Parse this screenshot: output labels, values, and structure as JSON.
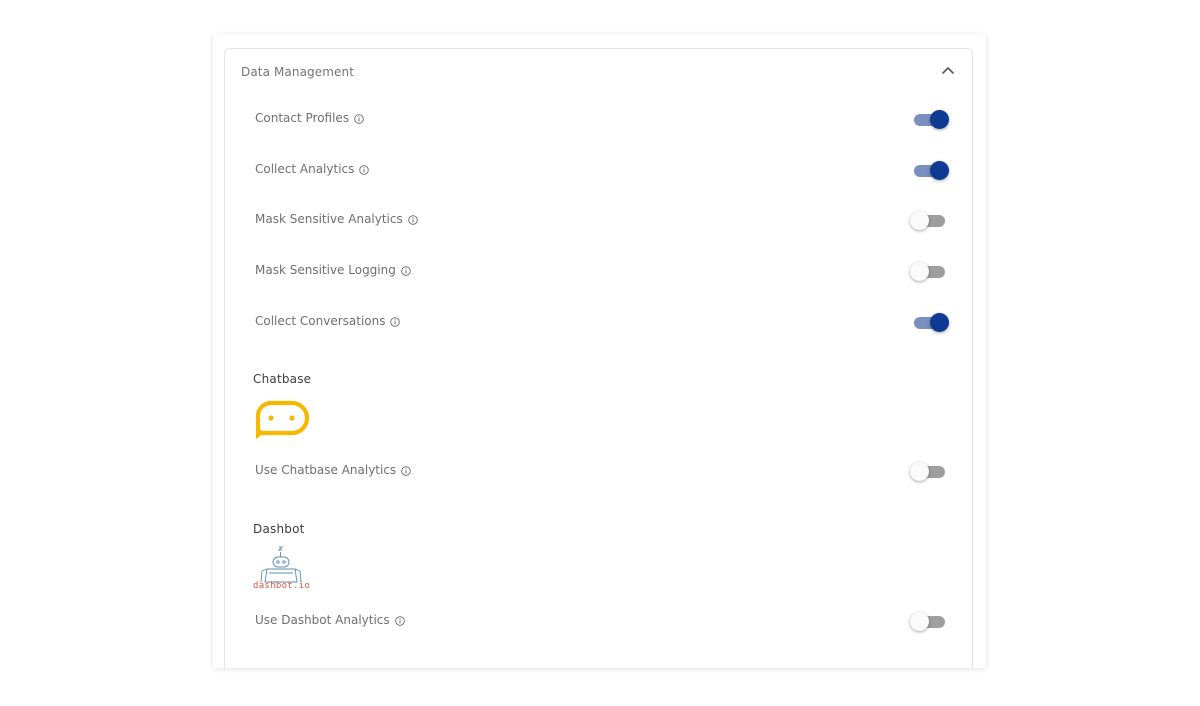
{
  "panel": {
    "title": "Data Management",
    "collapse_icon": "chevron-up-icon"
  },
  "settings": [
    {
      "label": "Contact Profiles",
      "enabled": true
    },
    {
      "label": "Collect Analytics",
      "enabled": true
    },
    {
      "label": "Mask Sensitive Analytics",
      "enabled": false
    },
    {
      "label": "Mask Sensitive Logging",
      "enabled": false
    },
    {
      "label": "Collect Conversations",
      "enabled": true
    }
  ],
  "chatbase": {
    "title": "Chatbase",
    "logo_icon": "chatbase-logo-icon",
    "logo_color": "#f5b800",
    "setting": {
      "label": "Use Chatbase Analytics",
      "enabled": false
    }
  },
  "dashbot": {
    "title": "Dashbot",
    "logo_icon": "dashbot-logo-icon",
    "logo_text": "dashbot.io",
    "setting": {
      "label": "Use Dashbot Analytics",
      "enabled": false
    }
  },
  "colors": {
    "toggle_on_thumb": "#0e3a94",
    "toggle_on_track": "#7b8fc0",
    "toggle_off_thumb": "#fafafa",
    "toggle_off_track": "#9e9e9e"
  }
}
